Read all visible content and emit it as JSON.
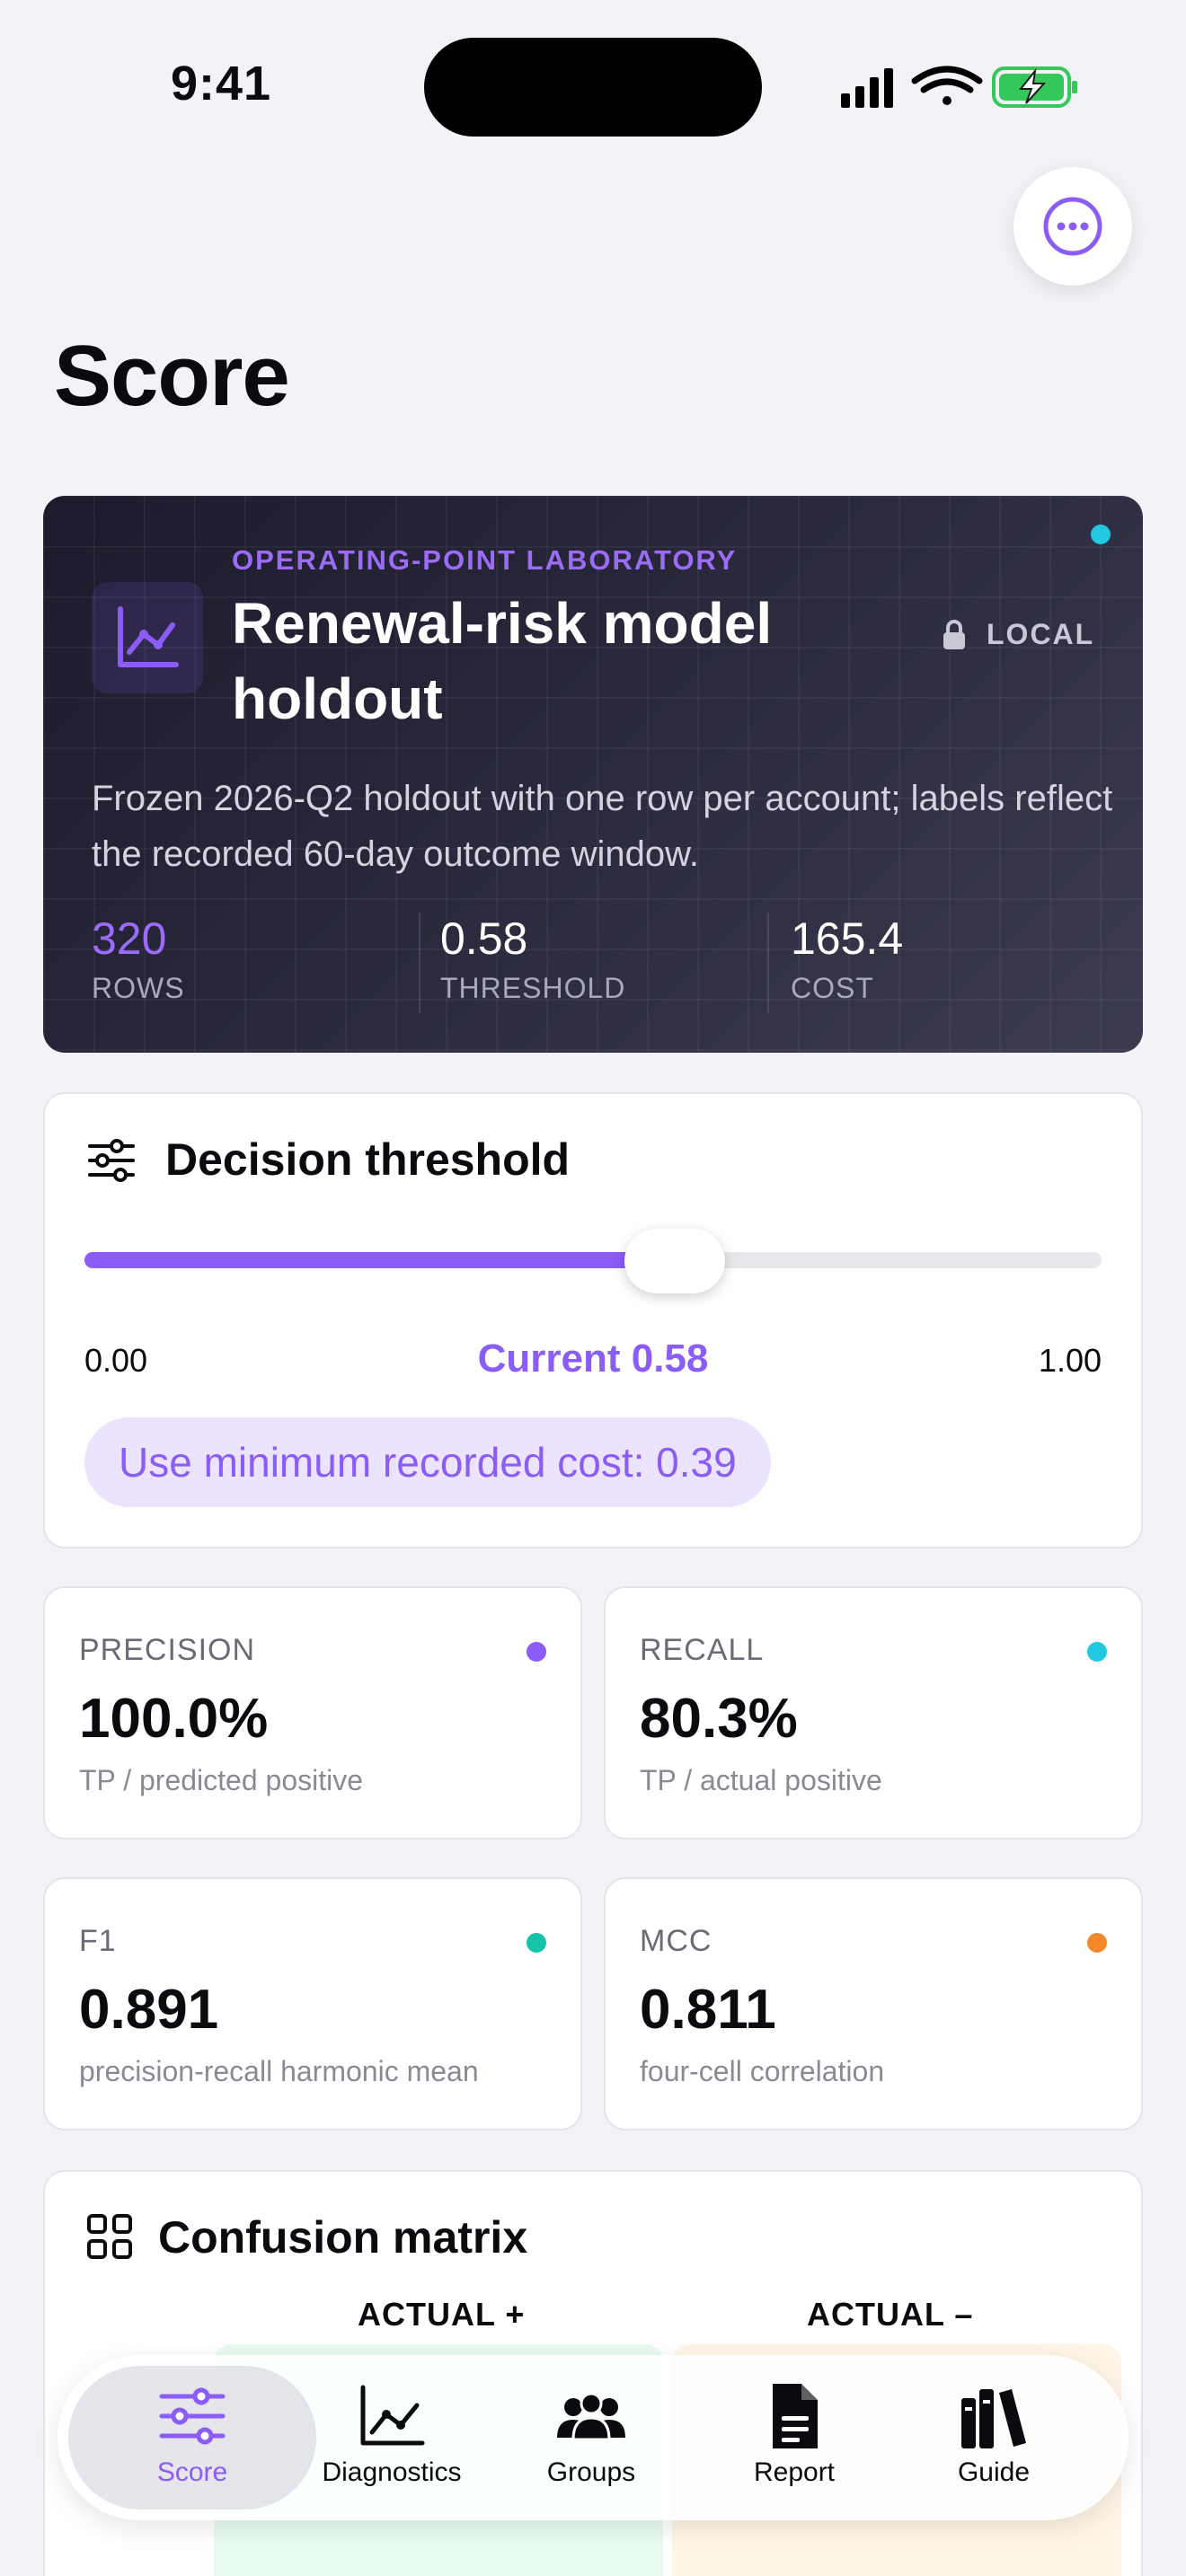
{
  "status": {
    "time": "9:41"
  },
  "page": {
    "title": "Score"
  },
  "hero": {
    "eyebrow": "OPERATING-POINT LABORATORY",
    "title": "Renewal-risk model holdout",
    "badge": "LOCAL",
    "description": "Frozen 2026-Q2 holdout with one row per account; labels reflect the recorded 60-day outcome window.",
    "stats": [
      {
        "value": "320",
        "label": "ROWS"
      },
      {
        "value": "0.58",
        "label": "THRESHOLD"
      },
      {
        "value": "165.4",
        "label": "COST"
      }
    ],
    "colors": {
      "accent": "#8b5cf6",
      "status_dot": "#22c7e0"
    }
  },
  "threshold": {
    "title": "Decision threshold",
    "min_label": "0.00",
    "max_label": "1.00",
    "current_label": "Current 0.58",
    "value": 0.58,
    "chip_label": "Use minimum recorded cost: 0.39"
  },
  "metrics": [
    {
      "label": "PRECISION",
      "value": "100.0%",
      "sub": "TP / predicted positive",
      "color": "#8b5cf6"
    },
    {
      "label": "RECALL",
      "value": "80.3%",
      "sub": "TP / actual positive",
      "color": "#22c7e0"
    },
    {
      "label": "F1",
      "value": "0.891",
      "sub": "precision-recall harmonic mean",
      "color": "#14c3a8"
    },
    {
      "label": "MCC",
      "value": "0.811",
      "sub": "four-cell correlation",
      "color": "#f4892b"
    }
  ],
  "confusion": {
    "title": "Confusion matrix",
    "col_actual_pos": "ACTUAL +",
    "col_actual_neg": "ACTUAL –"
  },
  "tabs": [
    {
      "label": "Score",
      "icon": "sliders-icon"
    },
    {
      "label": "Diagnostics",
      "icon": "line-chart-icon"
    },
    {
      "label": "Groups",
      "icon": "people-icon"
    },
    {
      "label": "Report",
      "icon": "document-icon"
    },
    {
      "label": "Guide",
      "icon": "books-icon"
    }
  ]
}
